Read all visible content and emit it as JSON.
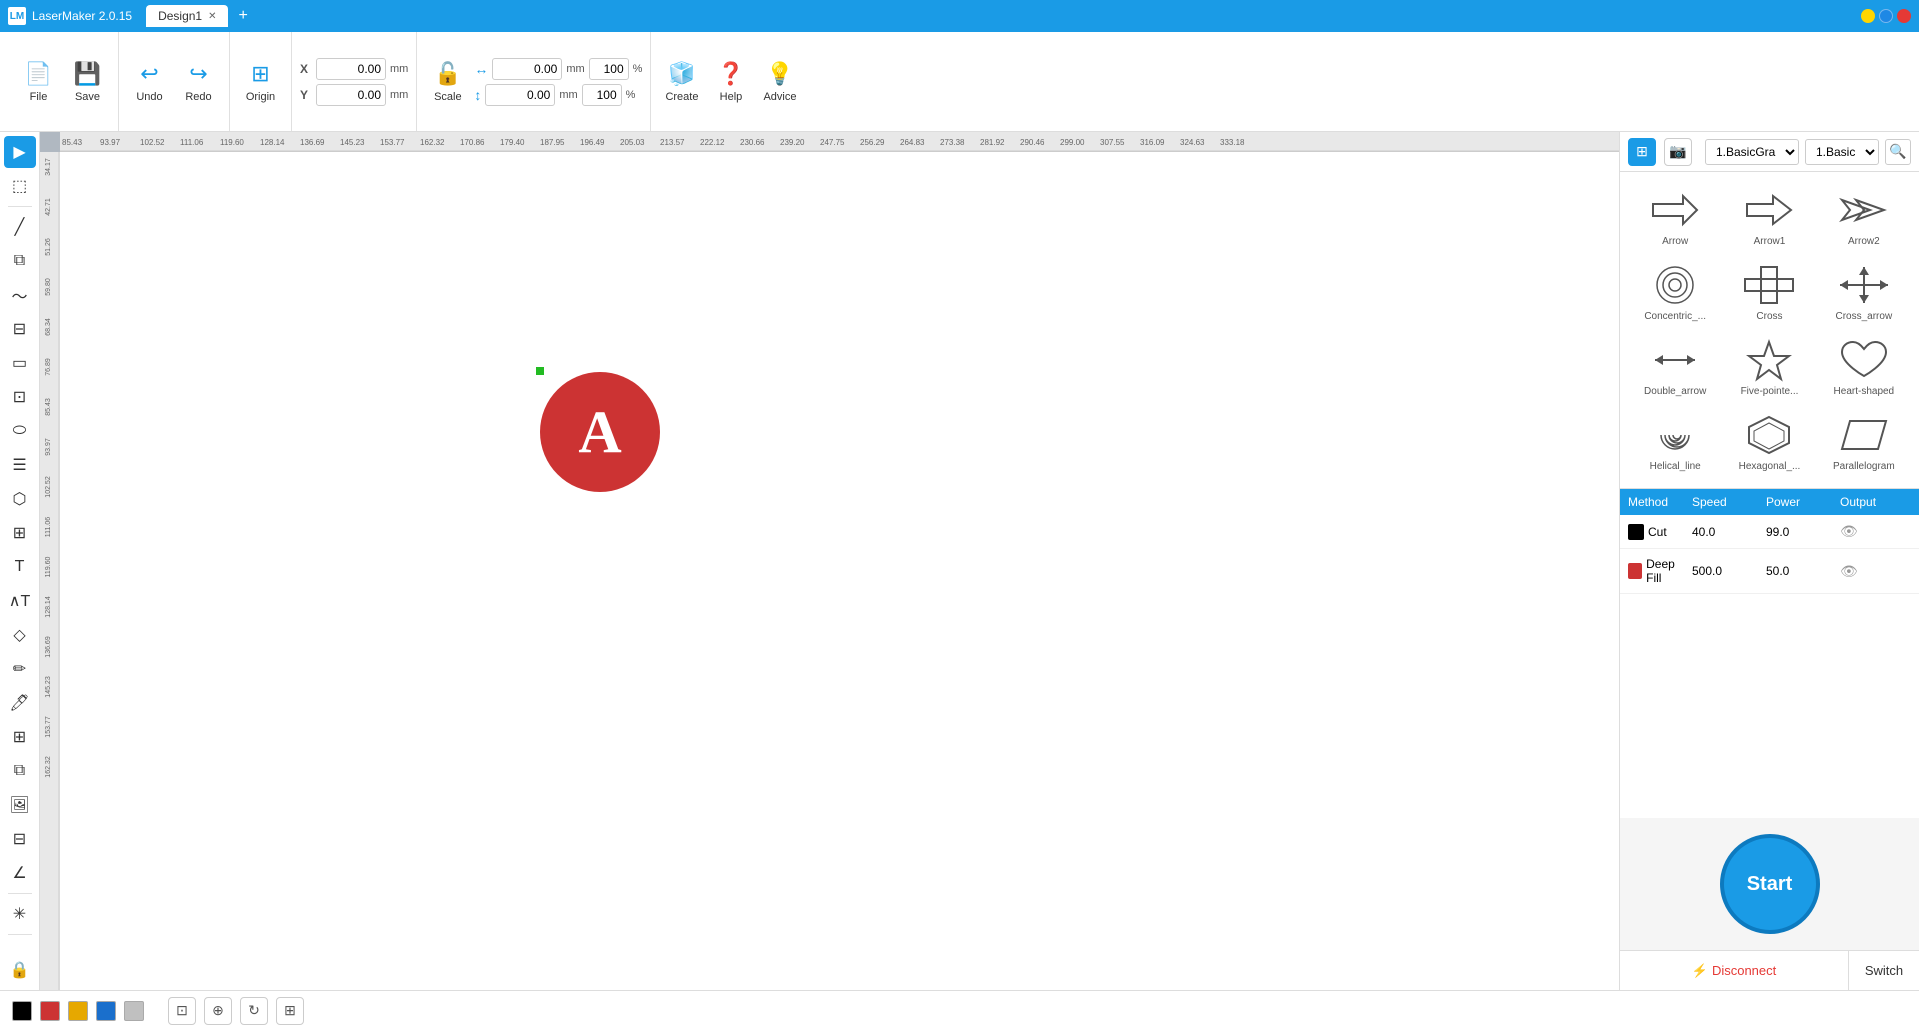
{
  "titlebar": {
    "app_icon": "LM",
    "app_title": "LaserMaker 2.0.15",
    "tab_name": "Design1",
    "add_tab": "+"
  },
  "toolbar": {
    "file_label": "File",
    "save_label": "Save",
    "undo_label": "Undo",
    "redo_label": "Redo",
    "origin_label": "Origin",
    "scale_label": "Scale",
    "create_label": "Create",
    "help_label": "Help",
    "advice_label": "Advice",
    "x_label": "X",
    "y_label": "Y",
    "x_value": "0.00",
    "y_value": "0.00",
    "w_value": "0.00",
    "h_value": "0.00",
    "w_pct": "100",
    "h_pct": "100",
    "mm": "mm",
    "pct": "%"
  },
  "shapes": [
    {
      "id": "arrow",
      "label": "Arrow"
    },
    {
      "id": "arrow1",
      "label": "Arrow1"
    },
    {
      "id": "arrow2",
      "label": "Arrow2"
    },
    {
      "id": "concentric",
      "label": "Concentric_..."
    },
    {
      "id": "cross",
      "label": "Cross"
    },
    {
      "id": "cross_arrow",
      "label": "Cross_arrow"
    },
    {
      "id": "double_arrow",
      "label": "Double_arrow"
    },
    {
      "id": "five_pointed",
      "label": "Five-pointe..."
    },
    {
      "id": "heart_shaped",
      "label": "Heart-shaped"
    },
    {
      "id": "helical_line",
      "label": "Helical_line"
    },
    {
      "id": "hexagonal",
      "label": "Hexagonal_..."
    },
    {
      "id": "parallelogram",
      "label": "Parallelogram"
    }
  ],
  "right_panel": {
    "dropdown1": "1.BasicGra",
    "dropdown2": "1.Basic",
    "layers_header": [
      "Method",
      "Speed",
      "Power",
      "Output"
    ],
    "layers": [
      {
        "color": "#000000",
        "name": "Cut",
        "speed": "40.0",
        "power": "99.0"
      },
      {
        "color": "#cc3333",
        "name": "Deep Fill",
        "speed": "500.0",
        "power": "50.0"
      }
    ],
    "start_label": "Start",
    "disconnect_label": "Disconnect",
    "switch_label": "Switch"
  },
  "bottom_bar": {
    "colors": [
      "#000000",
      "#cc3333",
      "#e6a800",
      "#1a6fcc",
      "#c0c0c0"
    ],
    "buttons": [
      "align",
      "snap",
      "rotate",
      "grid"
    ]
  },
  "canvas": {
    "ruler_h_numbers": [
      "85.43",
      "93.97",
      "102.52",
      "111.06",
      "119.60",
      "128.14",
      "136.69",
      "145.23",
      "153.77",
      "162.32",
      "170.86",
      "179.40",
      "187.95",
      "196.49",
      "205.03",
      "213.57",
      "222.12",
      "230.66",
      "239.20",
      "247.75",
      "256.29",
      "264.83",
      "273.38",
      "281.92",
      "290.46",
      "299.00",
      "307.55",
      "316.09",
      "324.63",
      "333.18"
    ],
    "ruler_v_numbers": [
      "34.17",
      "42.71",
      "51.26",
      "59.80",
      "68.34",
      "76.89",
      "85.43",
      "93.97",
      "102.52",
      "111.06",
      "119.60",
      "128.14",
      "136.69",
      "145.23",
      "153.77",
      "162.32"
    ]
  }
}
